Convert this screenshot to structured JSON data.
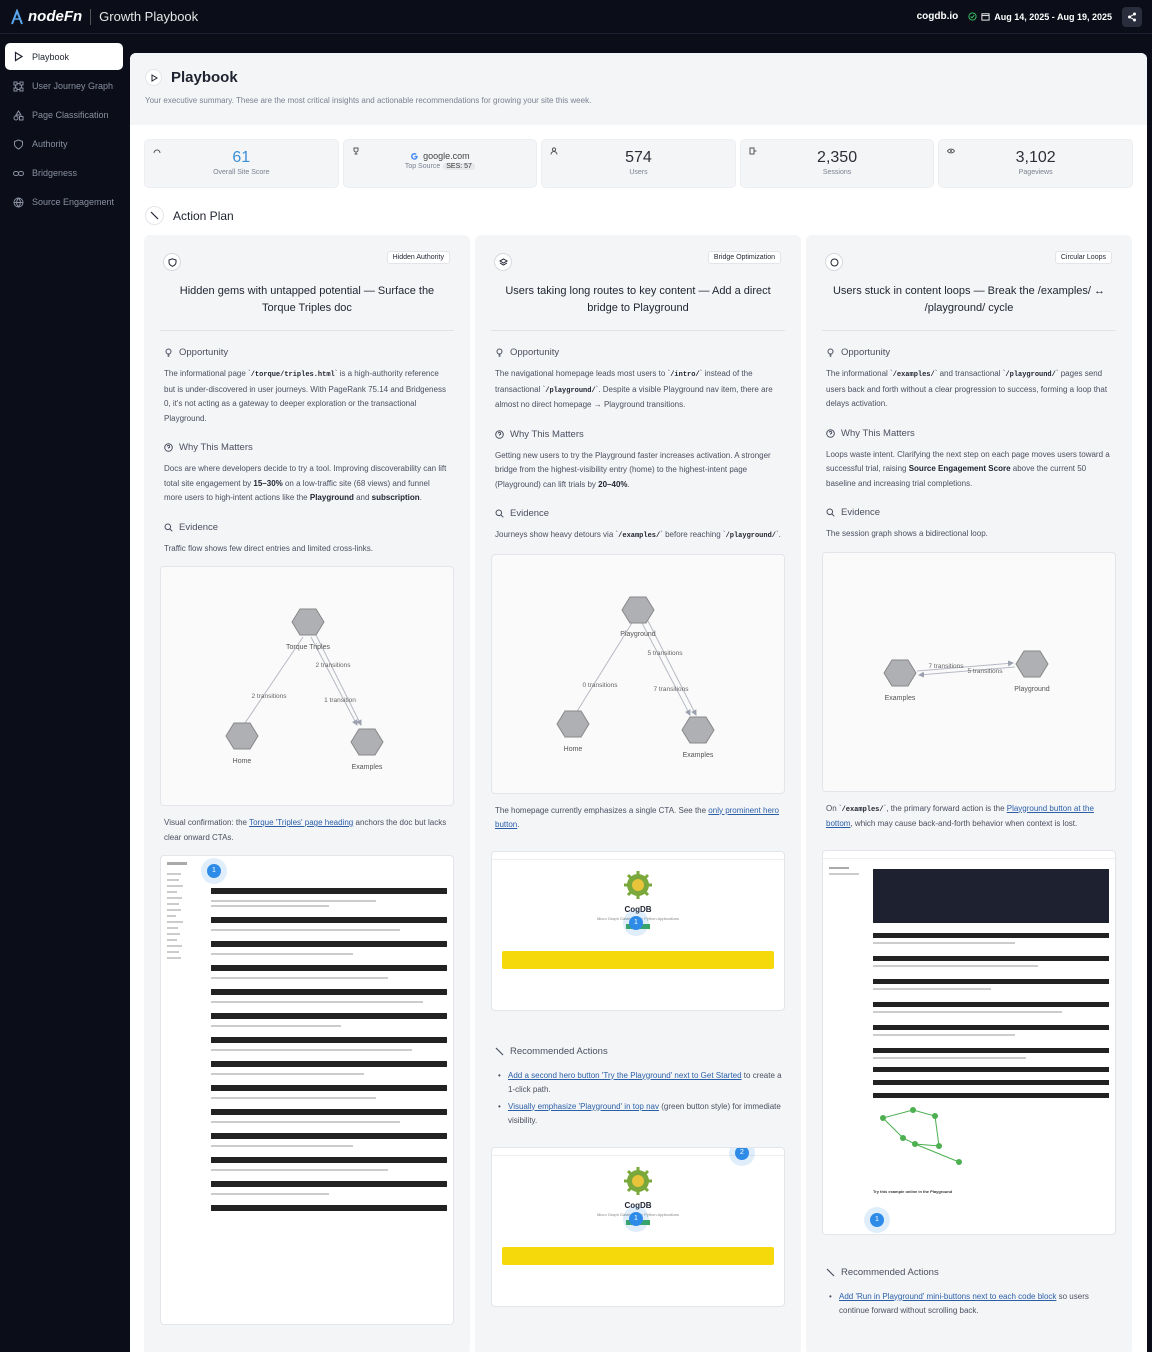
{
  "header": {
    "logo": "nodeFn",
    "title": "Growth Playbook",
    "domain": "cogdb.io",
    "date_range": "Aug 14, 2025 - Aug 19, 2025"
  },
  "sidebar": {
    "items": [
      {
        "label": "Playbook",
        "icon": "play-icon"
      },
      {
        "label": "User Journey Graph",
        "icon": "graph-icon"
      },
      {
        "label": "Page Classification",
        "icon": "shapes-icon"
      },
      {
        "label": "Authority",
        "icon": "shield-icon"
      },
      {
        "label": "Bridgeness",
        "icon": "link-icon"
      },
      {
        "label": "Source Engagement",
        "icon": "globe-icon"
      }
    ]
  },
  "page": {
    "title": "Playbook",
    "subtitle": "Your executive summary. These are the most critical insights and actionable recommendations for growing your site this week."
  },
  "stats": {
    "score": {
      "value": "61",
      "label": "Overall Site Score"
    },
    "source": {
      "value": "google.com",
      "label": "Top Source",
      "badge": "SES: 57"
    },
    "users": {
      "value": "574",
      "label": "Users"
    },
    "sessions": {
      "value": "2,350",
      "label": "Sessions"
    },
    "pageviews": {
      "value": "3,102",
      "label": "Pageviews"
    }
  },
  "action_plan": {
    "title": "Action Plan"
  },
  "sections": {
    "opportunity": "Opportunity",
    "why": "Why This Matters",
    "evidence": "Evidence",
    "recommended": "Recommended Actions"
  },
  "cards": [
    {
      "tag": "Hidden Authority",
      "title": "Hidden gems with untapped potential — Surface the Torque Triples doc",
      "evidence_text": "Traffic flow shows few direct entries and limited cross-links.",
      "graph": {
        "nodes": [
          "Torque Triples",
          "Home",
          "Examples"
        ],
        "edges": [
          "2 transitions",
          "2 transitions",
          "1 transition"
        ]
      },
      "visual": {
        "pre": "Visual confirmation: the ",
        "link": "Torque 'Triples' page heading",
        "post": " anchors the doc but lacks clear onward CTAs."
      }
    },
    {
      "tag": "Bridge Optimization",
      "title": "Users taking long routes to key content — Add a direct bridge to Playground",
      "graph": {
        "nodes": [
          "Playground",
          "Home",
          "Examples"
        ],
        "edges": [
          "5 transitions",
          "0 transitions",
          "7 transitions"
        ]
      },
      "visual": {
        "pre": "The homepage currently emphasizes a single CTA. See the ",
        "link": "only prominent hero button",
        "post": "."
      },
      "actions": [
        {
          "link": "Add a second hero button 'Try the Playground' next to Get Started",
          "post": " to create a 1-click path."
        },
        {
          "link": "Visually emphasize 'Playground' in top nav",
          "post": " (green button style) for immediate visibility."
        }
      ],
      "shot_title": "CogDB",
      "shot_sub": "Micro Graph Database for Python Applications"
    },
    {
      "tag": "Circular Loops",
      "title": "Users stuck in content loops — Break the /examples/ ↔ /playground/ cycle",
      "evidence_text": "The session graph shows a bidirectional loop.",
      "graph": {
        "nodes": [
          "Examples",
          "Playground"
        ],
        "edges": [
          "7 transitions",
          "5 transitions"
        ]
      },
      "actions": [
        {
          "link": "Add 'Run in Playground' mini-buttons next to each code block",
          "post": " so users continue forward without scrolling back."
        }
      ],
      "shot_caption": "Try this example online in the Playground"
    }
  ]
}
